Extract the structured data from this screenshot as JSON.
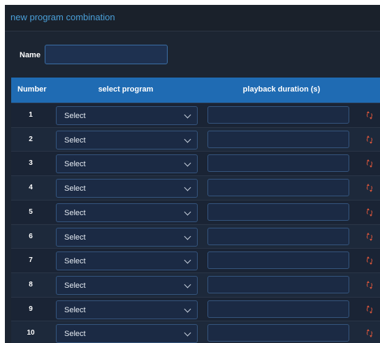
{
  "window": {
    "title": "new program combination"
  },
  "form": {
    "name_label": "Name",
    "name_value": ""
  },
  "table": {
    "headers": {
      "number": "Number",
      "program": "select program",
      "duration": "playback duration (s)"
    },
    "rows": [
      {
        "number": "1",
        "program": "Select",
        "duration": ""
      },
      {
        "number": "2",
        "program": "Select",
        "duration": ""
      },
      {
        "number": "3",
        "program": "Select",
        "duration": ""
      },
      {
        "number": "4",
        "program": "Select",
        "duration": ""
      },
      {
        "number": "5",
        "program": "Select",
        "duration": ""
      },
      {
        "number": "6",
        "program": "Select",
        "duration": ""
      },
      {
        "number": "7",
        "program": "Select",
        "duration": ""
      },
      {
        "number": "8",
        "program": "Select",
        "duration": ""
      },
      {
        "number": "9",
        "program": "Select",
        "duration": ""
      },
      {
        "number": "10",
        "program": "Select",
        "duration": ""
      }
    ]
  },
  "colors": {
    "header_bg": "#1f6bb3",
    "title": "#4a9fd8",
    "reset_icon": "#d8553a"
  },
  "icons": {
    "select_arrow": "chevron-down-icon",
    "row_action": "reset-icon"
  }
}
